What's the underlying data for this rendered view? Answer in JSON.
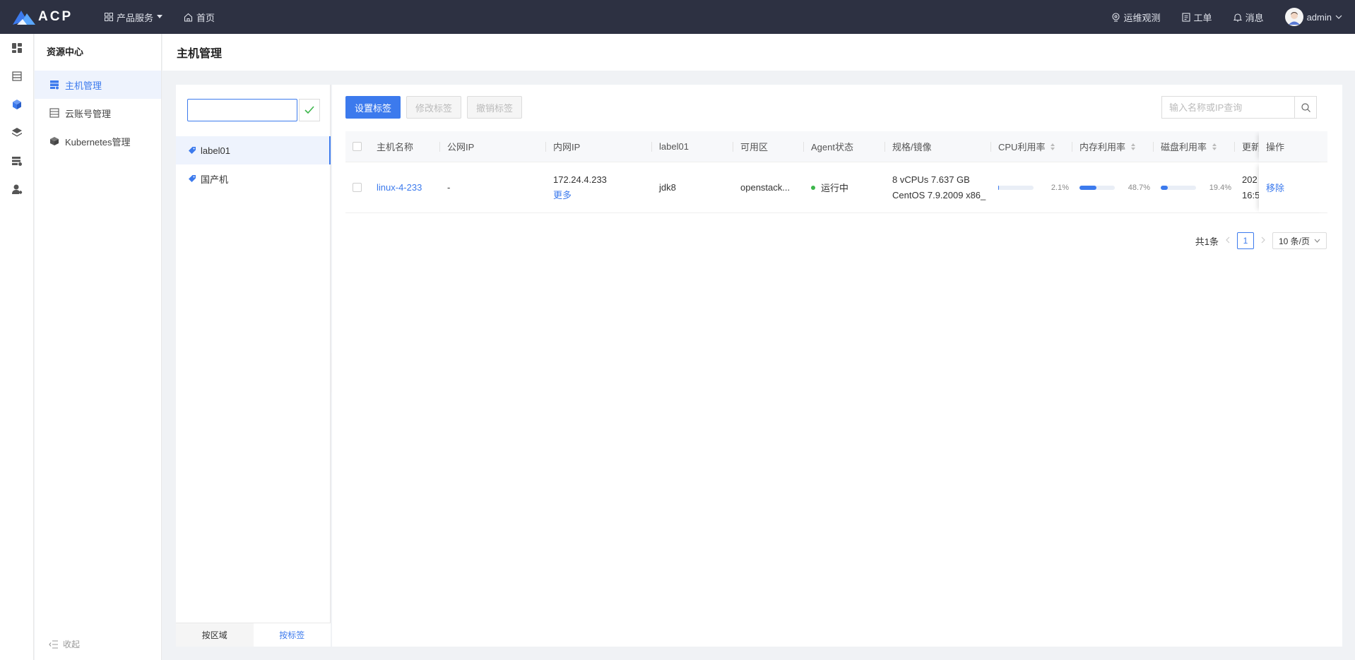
{
  "header": {
    "logo_text": "ACP",
    "nav": [
      {
        "label": "产品服务",
        "icon": "grid-icon"
      },
      {
        "label": "首页",
        "icon": "home-icon"
      }
    ],
    "right": [
      {
        "label": "运维观测",
        "icon": "monitor-icon"
      },
      {
        "label": "工单",
        "icon": "ticket-icon"
      },
      {
        "label": "消息",
        "icon": "bell-icon"
      }
    ],
    "user": "admin"
  },
  "sidebar": {
    "title": "资源中心",
    "items": [
      {
        "label": "主机管理",
        "icon": "host-icon",
        "active": true
      },
      {
        "label": "云账号管理",
        "icon": "cloud-account-icon"
      },
      {
        "label": "Kubernetes管理",
        "icon": "cube-icon"
      }
    ],
    "collapse_label": "收起"
  },
  "page": {
    "title": "主机管理"
  },
  "labels": {
    "input_value": "",
    "items": [
      {
        "label": "label01",
        "active": true
      },
      {
        "label": "国产机"
      }
    ],
    "tabs": [
      {
        "label": "按区域"
      },
      {
        "label": "按标签",
        "active": true
      }
    ]
  },
  "toolbar": {
    "set_tag": "设置标签",
    "edit_tag": "修改标签",
    "revoke_tag": "撤销标签",
    "search_placeholder": "输入名称或IP查询"
  },
  "table": {
    "columns": {
      "name": "主机名称",
      "public_ip": "公网IP",
      "private_ip": "内网IP",
      "label01": "label01",
      "zone": "可用区",
      "agent": "Agent状态",
      "spec": "规格/镜像",
      "cpu": "CPU利用率",
      "mem": "内存利用率",
      "disk": "磁盘利用率",
      "updated": "更新",
      "ops": "操作"
    },
    "rows": [
      {
        "name": "linux-4-233",
        "public_ip": "-",
        "private_ip": "172.24.4.233",
        "more": "更多",
        "label01": "jdk8",
        "zone": "openstack...",
        "agent": "运行中",
        "spec_line1": "8 vCPUs 7.637 GB",
        "spec_line2": "CentOS 7.9.2009 x86_",
        "cpu_pct": "2.1%",
        "cpu_value": 2.1,
        "mem_pct": "48.7%",
        "mem_value": 48.7,
        "disk_pct": "19.4%",
        "disk_value": 19.4,
        "updated_line1": "202",
        "updated_line2": "16:5",
        "op": "移除"
      }
    ]
  },
  "pagination": {
    "total": "共1条",
    "current": "1",
    "page_size": "10 条/页"
  },
  "colors": {
    "primary": "#3c7aed",
    "topbar": "#2d3142",
    "running": "#3cb64b"
  }
}
